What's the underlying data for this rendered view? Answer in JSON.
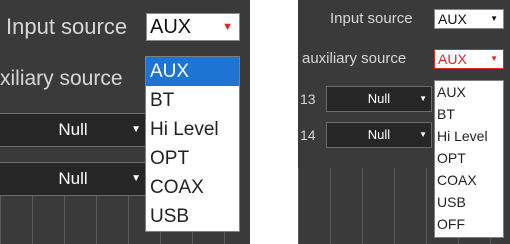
{
  "colors": {
    "panel_bg": "#3a3a3a",
    "highlight": "#1e74d2",
    "alert_red": "#e02525",
    "label_text": "#d7d7d7"
  },
  "left": {
    "input_source_label": "Input source",
    "input_source_value": "AUX",
    "auxiliary_source_label": "xiliary source",
    "rows": [
      {
        "value": "Null"
      },
      {
        "value": "Null"
      }
    ],
    "menu_items": [
      "AUX",
      "BT",
      "Hi Level",
      "OPT",
      "COAX",
      "USB"
    ],
    "menu_selected": "AUX"
  },
  "right": {
    "input_source_label": "Input source",
    "input_source_value": "AUX",
    "auxiliary_source_label": "auxiliary source",
    "auxiliary_source_value": "AUX",
    "rows": [
      {
        "index": "13",
        "value": "Null"
      },
      {
        "index": "14",
        "value": "Null"
      }
    ],
    "menu_items": [
      "AUX",
      "BT",
      "Hi Level",
      "OPT",
      "COAX",
      "USB",
      "OFF"
    ]
  }
}
